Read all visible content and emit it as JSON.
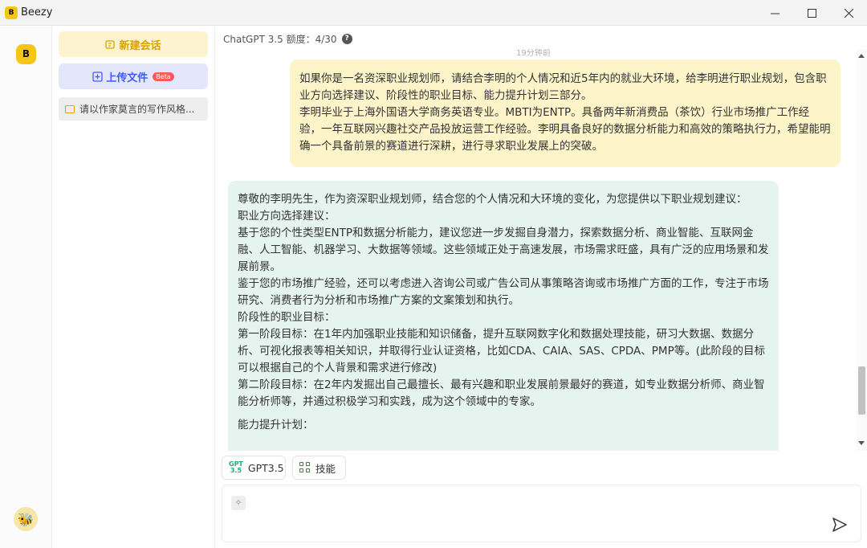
{
  "app": {
    "title": "Beezy",
    "logo_text": "B"
  },
  "window_controls": {
    "minimize": "—",
    "maximize": "☐",
    "close": "✕"
  },
  "sidebar": {
    "new_chat_label": "新建会话",
    "upload_label": "上传文件",
    "upload_badge": "Beta",
    "conversations": [
      {
        "title": "请以作家莫言的写作风格..."
      }
    ]
  },
  "header": {
    "quota_text": "ChatGPT 3.5 额度：4/30",
    "help_icon": "?"
  },
  "chat": {
    "timestamp": "19分钟前",
    "user_message": [
      "如果你是一名资深职业规划师，请结合李明的个人情况和近5年内的就业大环境，给李明进行职业规划，包含职业方向选择建议、阶段性的职业目标、能力提升计划三部分。",
      "李明毕业于上海外国语大学商务英语专业。MBTI为ENTP。具备两年新消费品（茶饮）行业市场推广工作经验，一年互联网兴趣社交产品投放运营工作经验。李明具备良好的数据分析能力和高效的策略执行力，希望能明确一个具备前景的赛道进行深耕，进行寻求职业发展上的突破。"
    ],
    "bot_message": [
      "尊敬的李明先生，作为资深职业规划师，结合您的个人情况和大环境的变化，为您提供以下职业规划建议：",
      "职业方向选择建议：",
      "基于您的个性类型ENTP和数据分析能力，建议您进一步发掘自身潜力，探索数据分析、商业智能、互联网金融、人工智能、机器学习、大数据等领域。这些领域正处于高速发展，市场需求旺盛，具有广泛的应用场景和发展前景。",
      "鉴于您的市场推广经验，还可以考虑进入咨询公司或广告公司从事策略咨询或市场推广方面的工作，专注于市场研究、消费者行为分析和市场推广方案的文案策划和执行。",
      "阶段性的职业目标：",
      "第一阶段目标：在1年内加强职业技能和知识储备，提升互联网数字化和数据处理技能，研习大数据、数据分析、可视化报表等相关知识，并取得行业认证资格，比如CDA、CAIA、SAS、CPDA、PMP等。(此阶段的目标可以根据自己的个人背景和需求进行修改)",
      "第二阶段目标：在2年内发掘出自己最擅长、最有兴趣和职业发展前景最好的赛道，如专业数据分析师、商业智能分析师等，并通过积极学习和实践，成为这个领域中的专家。",
      "能力提升计划："
    ]
  },
  "toolbar": {
    "model_label": "GPT3.5",
    "model_icon_text": "GPT 3.5",
    "skills_label": "技能"
  },
  "input": {
    "placeholder": ""
  },
  "colors": {
    "user_bubble": "#fdf4c9",
    "bot_bubble": "#e6f4ef",
    "accent_yellow": "#f5c518",
    "accent_blue": "#3d5afe"
  }
}
